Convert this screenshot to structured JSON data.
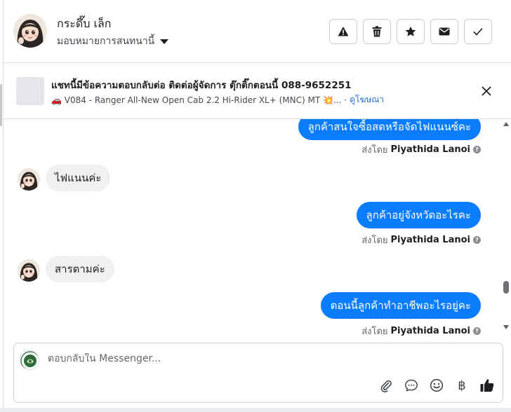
{
  "header": {
    "contact_name": "กระดึ๊บ เล็ก",
    "assign_label": "มอบหมายการสนทนานี้",
    "actions": [
      {
        "name": "report-button",
        "icon": "warning-icon"
      },
      {
        "name": "delete-button",
        "icon": "trash-icon"
      },
      {
        "name": "star-button",
        "icon": "star-icon"
      },
      {
        "name": "unread-button",
        "icon": "envelope-icon"
      },
      {
        "name": "done-button",
        "icon": "check-icon"
      }
    ]
  },
  "banner": {
    "title": "แชทนี้มีข้อความตอบกลับต่อ ติดต่อผู้จัดการ ตุ๊กติ๊กตอนนี้ 088-9652251",
    "subtitle": "🚗 V084 - Ranger All-New Open Cab 2.2 Hi-Rider XL+ (MNC) MT 💥...",
    "link": "ดูโฆษณา"
  },
  "messages": [
    {
      "direction": "out",
      "text": "ลูกค้าสนใจซื้อสดหรือจัดไฟแนนซ์คะ"
    },
    {
      "direction": "in",
      "text": "ไฟแนนค่ะ"
    },
    {
      "direction": "out",
      "text": "ลูกค้าอยู่จังหวัดอะไรคะ"
    },
    {
      "direction": "in",
      "text": "สารตามค่ะ"
    },
    {
      "direction": "out",
      "text": "ตอนนี้ลูกค้าทำอาชีพอะไรอยู่คะ"
    }
  ],
  "sent_by": {
    "prefix": "ส่งโดย",
    "name": "Piyathida Lanoi",
    "info": "?"
  },
  "composer": {
    "placeholder": "ตอบกลับใน Messenger...",
    "tools": [
      "paperclip-icon",
      "chat-bubble-icon",
      "emoji-icon",
      "baht-icon",
      "thumbs-up-icon"
    ],
    "baht_symbol": "฿"
  },
  "colors": {
    "outgoing_bubble": "#0a7cff",
    "incoming_bubble": "#f0f0f0",
    "link": "#216fdb"
  }
}
